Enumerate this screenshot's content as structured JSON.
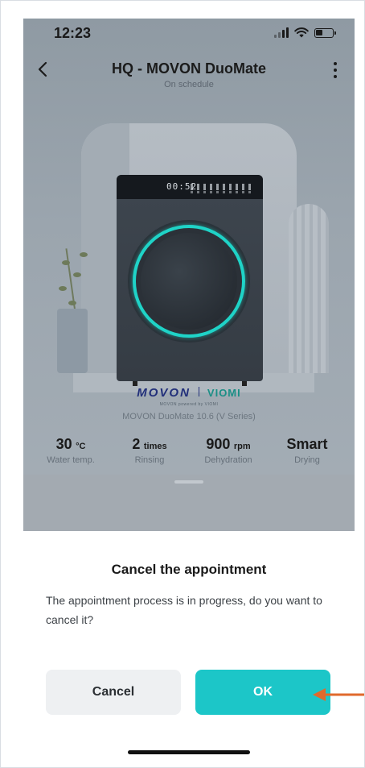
{
  "status_bar": {
    "time": "12:23"
  },
  "header": {
    "title": "HQ  - MOVON DuoMate",
    "subtitle": "On schedule"
  },
  "device": {
    "display_time": "00:52",
    "brand_primary": "MOVON",
    "brand_secondary": "VIOMI",
    "brand_tagline": "MOVON powered by VIOMI",
    "model_name": "MOVON DuoMate 10.6 (V Series)"
  },
  "specs": [
    {
      "value": "30",
      "unit": "°C",
      "label": "Water temp."
    },
    {
      "value": "2",
      "unit": "times",
      "label": "Rinsing"
    },
    {
      "value": "900",
      "unit": "rpm",
      "label": "Dehydration"
    },
    {
      "value": "Smart",
      "unit": "",
      "label": "Drying"
    }
  ],
  "dialog": {
    "title": "Cancel the appointment",
    "message": "The appointment process is in progress, do you want to cancel it?",
    "cancel_label": "Cancel",
    "ok_label": "OK"
  },
  "colors": {
    "accent": "#1cc6c8",
    "cancel_bg": "#eef0f2",
    "annotation_arrow": "#e06a2c",
    "ring_glow": "#1fd3c7"
  },
  "icons": {
    "back": "chevron-left-icon",
    "more": "more-vertical-icon",
    "signal": "signal-icon",
    "wifi": "wifi-icon",
    "battery": "battery-icon"
  }
}
